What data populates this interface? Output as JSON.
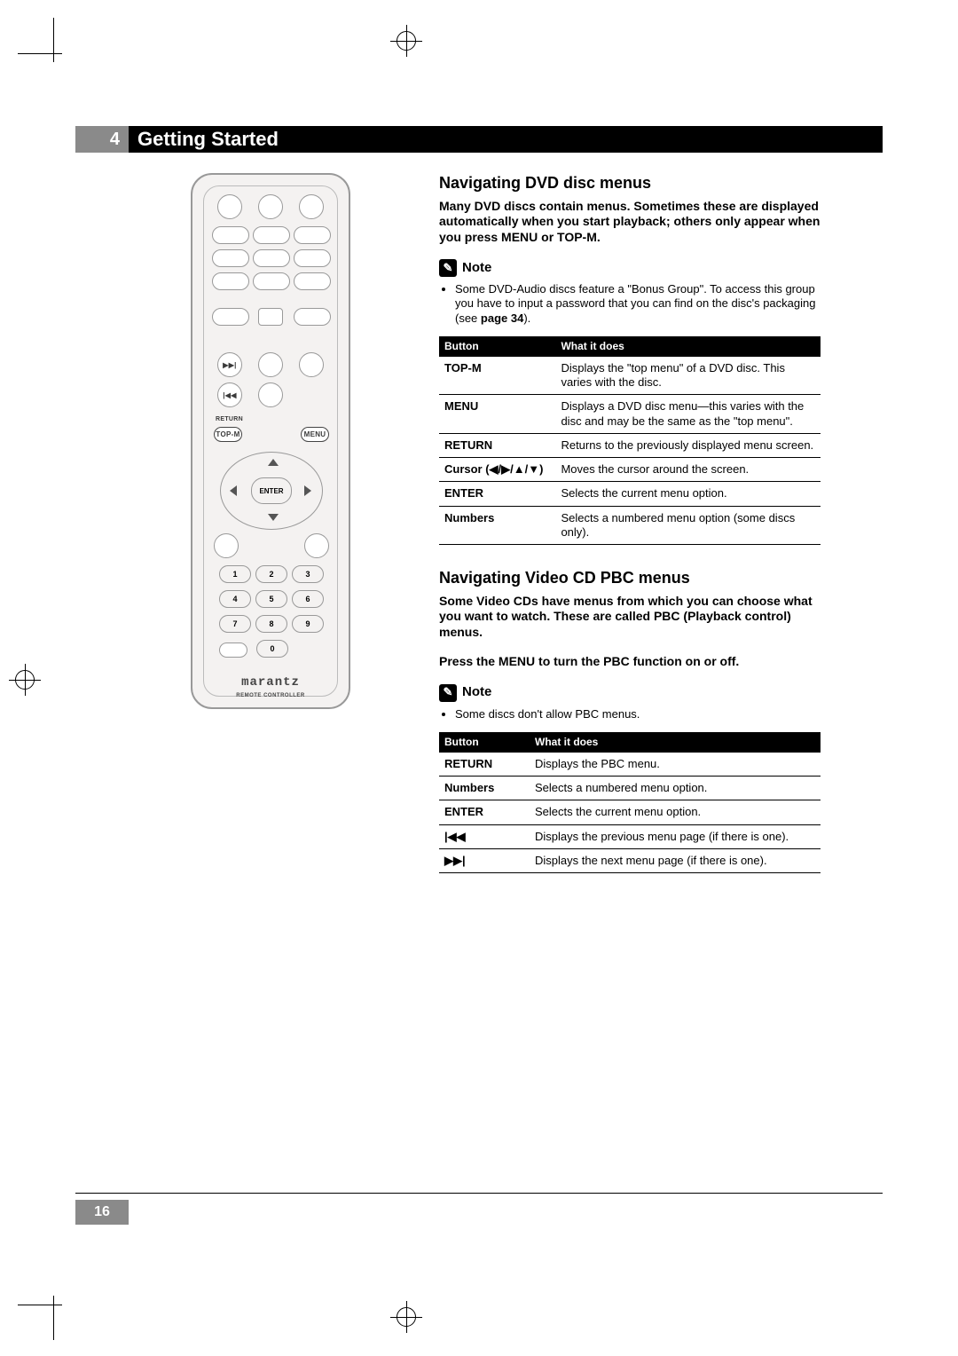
{
  "chapter_num": "4",
  "chapter_title": "Getting Started",
  "page_number": "16",
  "remote": {
    "brand": "marantz",
    "brand_sub": "REMOTE CONTROLLER",
    "topm": "TOP-M",
    "menu": "MENU",
    "return": "RETURN",
    "enter": "ENTER",
    "numbers": [
      "1",
      "2",
      "3",
      "4",
      "5",
      "6",
      "7",
      "8",
      "9",
      "0"
    ],
    "fwd": "▶▶|",
    "rev": "|◀◀"
  },
  "section1": {
    "heading": "Navigating DVD disc menus",
    "intro": "Many DVD discs contain menus. Sometimes these are displayed automatically when you start playback; others only appear when you press MENU or TOP-M.",
    "note_label": "Note",
    "note_item_prefix": "Some DVD-Audio discs feature a \"Bonus Group\". To access this group you have to input a password that you can find on the disc's packaging (see ",
    "note_item_page": "page 34",
    "note_item_suffix": ").",
    "table": {
      "col1": "Button",
      "col2": "What it does",
      "rows": [
        {
          "b": "TOP-M",
          "d": "Displays the \"top menu\" of a DVD disc. This varies with the disc."
        },
        {
          "b": "MENU",
          "d": "Displays a DVD disc menu—this varies with the disc and may be the same as the \"top menu\"."
        },
        {
          "b": "RETURN",
          "d": "Returns to the previously displayed menu screen."
        },
        {
          "b": "Cursor (◀/▶/▲/▼)",
          "d": "Moves the cursor around the screen."
        },
        {
          "b": "ENTER",
          "d": "Selects the current menu option."
        },
        {
          "b": "Numbers",
          "d": "Selects a numbered menu option (some discs only)."
        }
      ]
    }
  },
  "section2": {
    "heading": "Navigating Video CD PBC menus",
    "intro1": "Some Video CDs have menus from which you can choose what you want to watch. These are called PBC (Playback control) menus.",
    "intro2": "Press the MENU to turn the PBC function on or off.",
    "note_label": "Note",
    "note_item": "Some discs don't allow PBC menus.",
    "table": {
      "col1": "Button",
      "col2": "What it does",
      "rows": [
        {
          "b": "RETURN",
          "d": "Displays the PBC menu."
        },
        {
          "b": "Numbers",
          "d": "Selects a numbered menu option."
        },
        {
          "b": "ENTER",
          "d": "Selects the current menu option."
        },
        {
          "b": "|◀◀",
          "d": "Displays the previous menu page (if there is one)."
        },
        {
          "b": "▶▶|",
          "d": "Displays the next menu page (if there is one)."
        }
      ]
    }
  }
}
